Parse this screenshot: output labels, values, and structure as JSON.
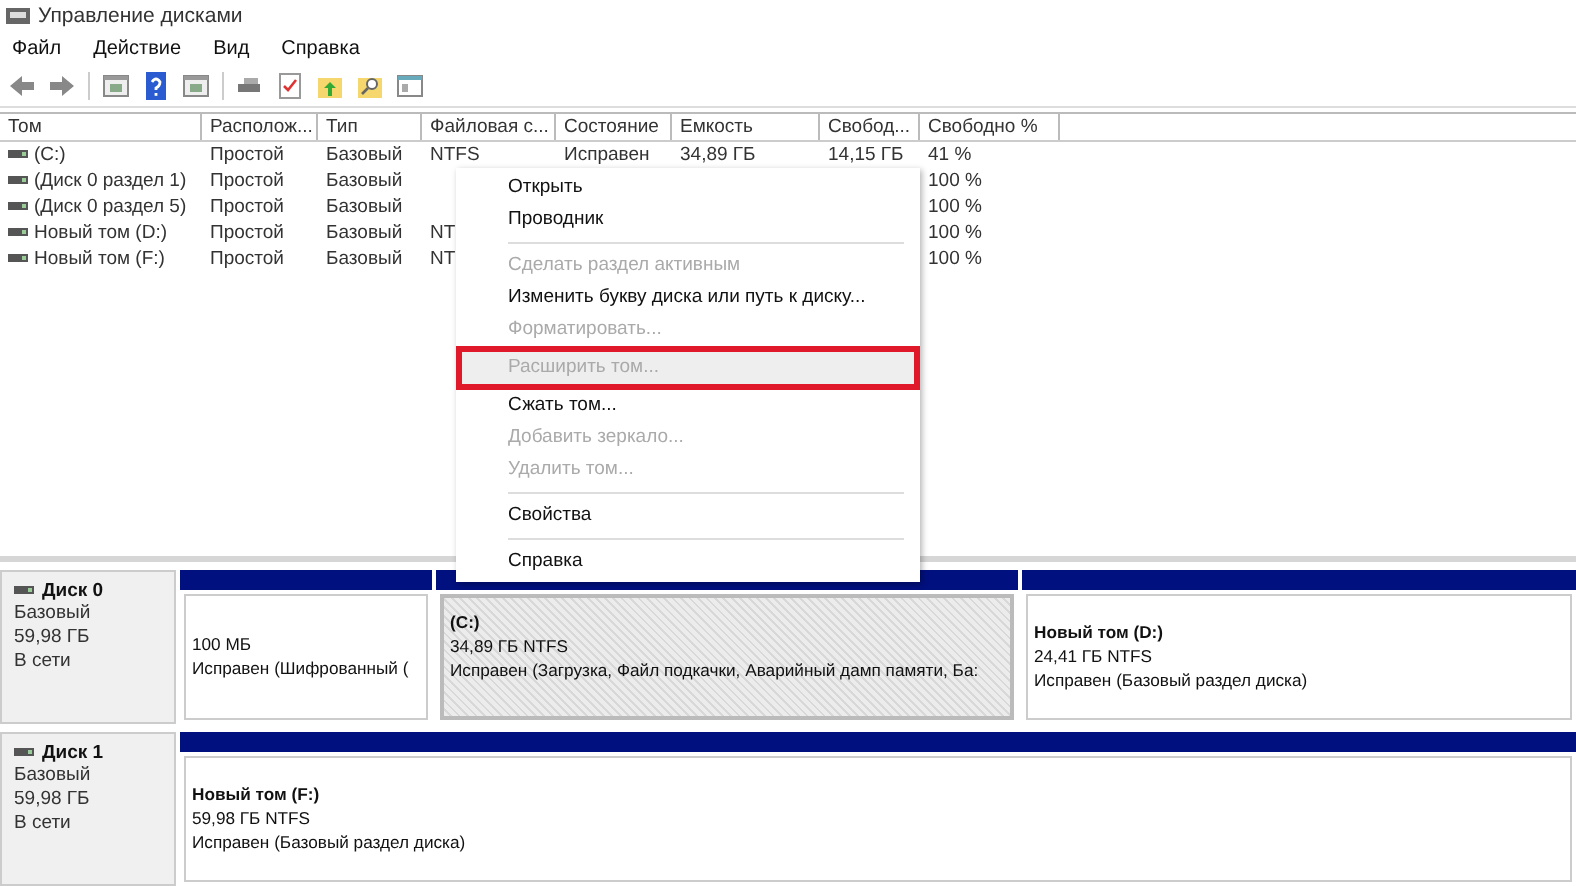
{
  "window": {
    "title": "Управление дисками"
  },
  "menubar": [
    "Файл",
    "Действие",
    "Вид",
    "Справка"
  ],
  "toolbar": [
    {
      "kind": "back"
    },
    {
      "kind": "forward"
    },
    {
      "kind": "separator"
    },
    {
      "kind": "panel"
    },
    {
      "kind": "help"
    },
    {
      "kind": "panel"
    },
    {
      "kind": "separator"
    },
    {
      "kind": "disk"
    },
    {
      "kind": "check"
    },
    {
      "kind": "folder-up"
    },
    {
      "kind": "folder-search"
    },
    {
      "kind": "window"
    }
  ],
  "table": {
    "columns": [
      "Том",
      "Располож...",
      "Тип",
      "Файловая с...",
      "Состояние",
      "Емкость",
      "Свобод...",
      "Свободно %"
    ],
    "rows": [
      {
        "cells": [
          "(C:)",
          "Простой",
          "Базовый",
          "NTFS",
          "Исправен",
          "34,89 ГБ",
          "14,15 ГБ",
          "41 %"
        ]
      },
      {
        "cells": [
          "(Диск 0 раздел 1)",
          "Простой",
          "Базовый",
          null,
          null,
          null,
          null,
          "100 %"
        ]
      },
      {
        "cells": [
          "(Диск 0 раздел 5)",
          "Простой",
          "Базовый",
          null,
          null,
          null,
          null,
          "100 %"
        ]
      },
      {
        "cells": [
          "Новый том (D:)",
          "Простой",
          "Базовый",
          "NT",
          null,
          null,
          null,
          "100 %"
        ]
      },
      {
        "cells": [
          "Новый том (F:)",
          "Простой",
          "Базовый",
          "NT",
          null,
          null,
          null,
          "100 %"
        ]
      }
    ]
  },
  "context_menu": [
    {
      "kind": "item",
      "label": "Открыть",
      "disabled": false,
      "highlighted": false
    },
    {
      "kind": "item",
      "label": "Проводник",
      "disabled": false,
      "highlighted": false
    },
    {
      "kind": "separator"
    },
    {
      "kind": "item",
      "label": "Сделать раздел активным",
      "disabled": true,
      "highlighted": false
    },
    {
      "kind": "item",
      "label": "Изменить букву диска или путь к диску...",
      "disabled": false,
      "highlighted": false
    },
    {
      "kind": "item",
      "label": "Форматировать...",
      "disabled": true,
      "highlighted": false
    },
    {
      "kind": "item",
      "label": "Расширить том...",
      "disabled": true,
      "highlighted": true
    },
    {
      "kind": "item",
      "label": "Сжать том...",
      "disabled": false,
      "highlighted": false
    },
    {
      "kind": "item",
      "label": "Добавить зеркало...",
      "disabled": true,
      "highlighted": false
    },
    {
      "kind": "item",
      "label": "Удалить том...",
      "disabled": true,
      "highlighted": false
    },
    {
      "kind": "separator"
    },
    {
      "kind": "item",
      "label": "Свойства",
      "disabled": false,
      "highlighted": false
    },
    {
      "kind": "separator"
    },
    {
      "kind": "item",
      "label": "Справка",
      "disabled": false,
      "highlighted": false
    }
  ],
  "disks": [
    {
      "name": "Диск 0",
      "type": "Базовый",
      "size": "59,98 ГБ",
      "status": "В сети",
      "partitions": [
        {
          "size": "100 МБ",
          "status": "Исправен (Шифрованный (",
          "selected": false
        },
        {
          "title": "(C:)",
          "size": "34,89 ГБ NTFS",
          "status": "Исправен (Загрузка, Файл подкачки, Аварийный дамп памяти, Ба:",
          "selected": true
        },
        {
          "title": "Новый том  (D:)",
          "size": "24,41 ГБ NTFS",
          "status": "Исправен (Базовый раздел диска)",
          "selected": false
        }
      ]
    },
    {
      "name": "Диск 1",
      "type": "Базовый",
      "size": "59,98 ГБ",
      "status": "В сети",
      "partitions": [
        {
          "title": "Новый том  (F:)",
          "size": "59,98 ГБ NTFS",
          "status": "Исправен (Базовый раздел диска)",
          "selected": false
        }
      ]
    }
  ]
}
